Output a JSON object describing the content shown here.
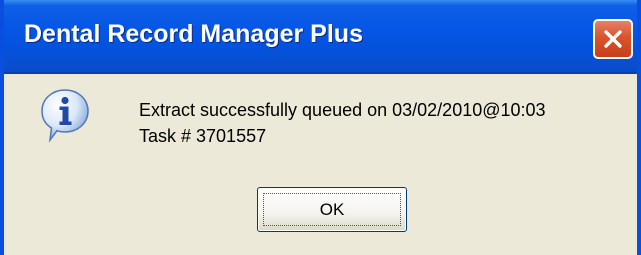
{
  "window": {
    "title": "Dental Record Manager Plus"
  },
  "icons": {
    "info": "information-icon",
    "close": "close-icon"
  },
  "message": {
    "line1": "Extract successfully queued on 03/02/2010@10:03",
    "line2": "Task # 3701557"
  },
  "buttons": {
    "ok_label": "OK"
  },
  "colors": {
    "titlebar": "#0656e6",
    "dialog_background": "#ece9d8",
    "close_button": "#d9532b"
  }
}
